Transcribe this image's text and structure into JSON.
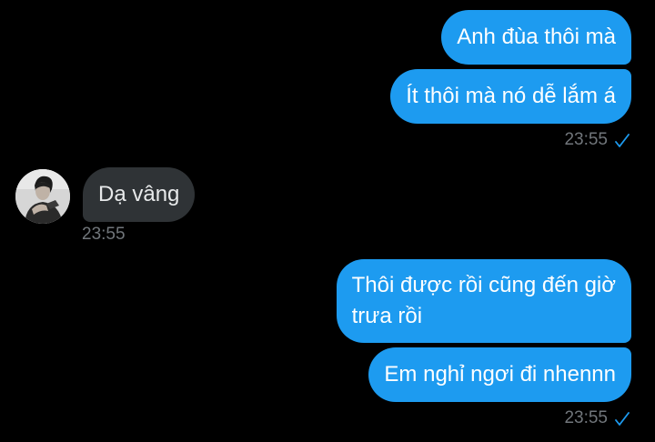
{
  "colors": {
    "background": "#000000",
    "outgoing_bubble": "#1d9bf0",
    "incoming_bubble": "#2f3336",
    "timestamp": "#71767b",
    "read_check": "#1d9bf0"
  },
  "messages": [
    {
      "direction": "outgoing",
      "text": "Anh đùa thôi mà"
    },
    {
      "direction": "outgoing",
      "text": "Ít thôi mà nó dễ lắm á",
      "time": "23:55",
      "status_icon": "check-icon"
    },
    {
      "direction": "incoming",
      "text": "Dạ vâng",
      "time": "23:55",
      "avatar_icon": "contact-avatar"
    },
    {
      "direction": "outgoing",
      "lines": [
        "Thôi được rồi cũng đến giờ",
        "trưa rồi"
      ]
    },
    {
      "direction": "outgoing",
      "text": "Em nghỉ ngơi đi nhennn",
      "time": "23:55",
      "status_icon": "check-icon"
    }
  ]
}
